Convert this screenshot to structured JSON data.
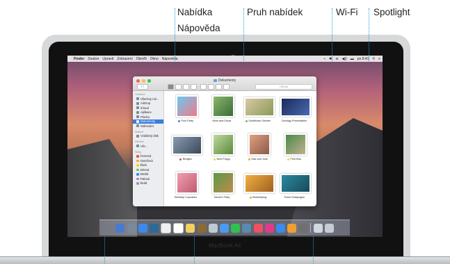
{
  "callouts": {
    "help_menu_line1": "Nabídka",
    "help_menu_line2": "Nápověda",
    "menu_bar": "Pruh nabídek",
    "wifi": "Wi-Fi",
    "spotlight": "Spotlight"
  },
  "device_label": "MacBook Air",
  "menubar": {
    "apple_glyph": "",
    "items": [
      "Finder",
      "Soubor",
      "Upravit",
      "Zobrazení",
      "Otevřít",
      "Okno",
      "Nápověda"
    ],
    "clock": "po 8:41",
    "status_glyphs": [
      "⌁",
      "✱",
      "≋",
      "◀))",
      "▬"
    ]
  },
  "finder": {
    "title": "Dokumenty",
    "search_placeholder": "Hledat",
    "nav_label": "‹ ›",
    "sidebar": {
      "favorites_header": "Oblíbené",
      "favorites": [
        "Všechny mé...",
        "AirDrop",
        "iCloud",
        "Aplikace",
        "Plocha",
        "Dokumenty",
        "Stahování"
      ],
      "selected_index": 5,
      "shared_header": "Sdílené",
      "shared": [
        "Vzdálený disk"
      ],
      "devices_header": "Zařízení",
      "devices": [
        "Věc..."
      ],
      "tags_header": "Štítky",
      "tags": [
        {
          "label": "Červená",
          "color": "#f0463c"
        },
        {
          "label": "Oranžová",
          "color": "#f5a623"
        },
        {
          "label": "Žlutá",
          "color": "#f5d328"
        },
        {
          "label": "Zelená",
          "color": "#5bc43f"
        },
        {
          "label": "Modrá",
          "color": "#3a82f6"
        },
        {
          "label": "Fialová",
          "color": "#b56ee0"
        },
        {
          "label": "Šedá",
          "color": "#9a9a9a"
        }
      ]
    },
    "files": [
      {
        "label": "Pool Party",
        "tag": "#3a82f6"
      },
      {
        "label": "Mom and Oscar",
        "tag": ""
      },
      {
        "label": "Southtown Garden",
        "tag": "#5bc43f"
      },
      {
        "label": "Geology Presentation",
        "tag": ""
      },
      {
        "label": "Bridges",
        "tag": "#f0463c"
      },
      {
        "label": "New Puppy",
        "tag": "#f5d328"
      },
      {
        "label": "Max and Julie",
        "tag": "#f5a623"
      },
      {
        "label": "First Kiss",
        "tag": "#f5d328"
      },
      {
        "label": "Birthday Cupcakes",
        "tag": ""
      },
      {
        "label": "Sarah's Party",
        "tag": ""
      },
      {
        "label": "Beekeeping",
        "tag": "#f5a623"
      },
      {
        "label": "Travel Galapagos",
        "tag": ""
      }
    ],
    "dock_count": 22
  },
  "colors": {
    "callout_line": "#1e9fd6"
  }
}
